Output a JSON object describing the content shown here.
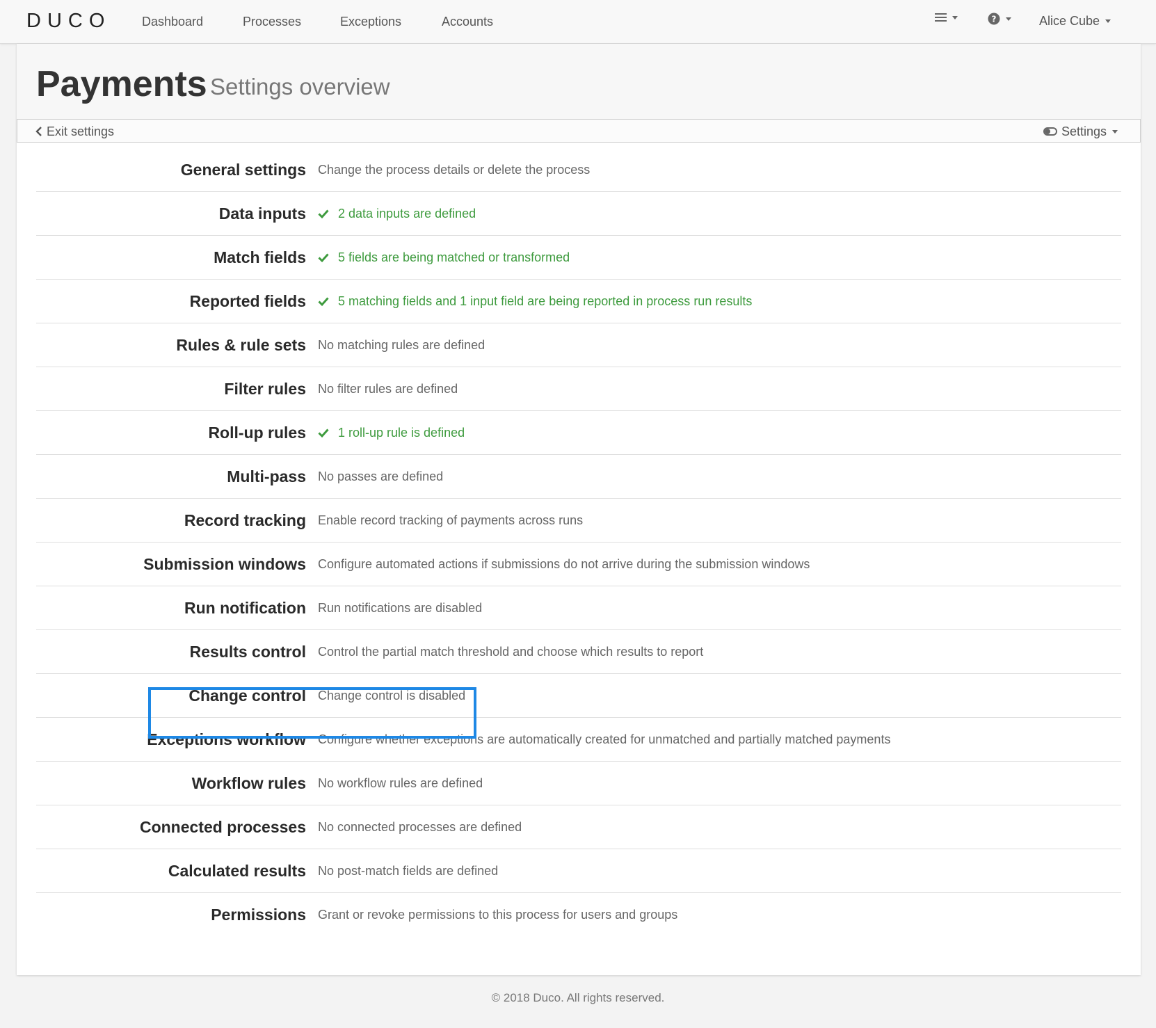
{
  "nav": {
    "logo": "DUCO",
    "links": [
      "Dashboard",
      "Processes",
      "Exceptions",
      "Accounts"
    ],
    "user": "Alice Cube"
  },
  "header": {
    "title": "Payments",
    "subtitle": "Settings overview"
  },
  "subbar": {
    "exit_label": "Exit settings",
    "settings_label": "Settings"
  },
  "settings": [
    {
      "label": "General settings",
      "desc": "Change the process details or delete the process",
      "ok": false
    },
    {
      "label": "Data inputs",
      "desc": "2 data inputs are defined",
      "ok": true
    },
    {
      "label": "Match fields",
      "desc": "5 fields are being matched or transformed",
      "ok": true
    },
    {
      "label": "Reported fields",
      "desc": "5 matching fields and 1 input field are being reported in process run results",
      "ok": true
    },
    {
      "label": "Rules & rule sets",
      "desc": "No matching rules are defined",
      "ok": false
    },
    {
      "label": "Filter rules",
      "desc": "No filter rules are defined",
      "ok": false
    },
    {
      "label": "Roll-up rules",
      "desc": "1 roll-up rule is defined",
      "ok": true
    },
    {
      "label": "Multi-pass",
      "desc": "No passes are defined",
      "ok": false
    },
    {
      "label": "Record tracking",
      "desc": "Enable record tracking of payments across runs",
      "ok": false
    },
    {
      "label": "Submission windows",
      "desc": "Configure automated actions if submissions do not arrive during the submission windows",
      "ok": false
    },
    {
      "label": "Run notification",
      "desc": "Run notifications are disabled",
      "ok": false
    },
    {
      "label": "Results control",
      "desc": "Control the partial match threshold and choose which results to report",
      "ok": false
    },
    {
      "label": "Change control",
      "desc": "Change control is disabled",
      "ok": false
    },
    {
      "label": "Exceptions workflow",
      "desc": "Configure whether exceptions are automatically created for unmatched and partially matched payments",
      "ok": false
    },
    {
      "label": "Workflow rules",
      "desc": "No workflow rules are defined",
      "ok": false
    },
    {
      "label": "Connected processes",
      "desc": "No connected processes are defined",
      "ok": false
    },
    {
      "label": "Calculated results",
      "desc": "No post-match fields are defined",
      "ok": false
    },
    {
      "label": "Permissions",
      "desc": "Grant or revoke permissions to this process for users and groups",
      "ok": false
    }
  ],
  "footer": "© 2018 Duco. All rights reserved.",
  "colors": {
    "accent": "#1e88e5",
    "ok": "#3e9b3e"
  }
}
